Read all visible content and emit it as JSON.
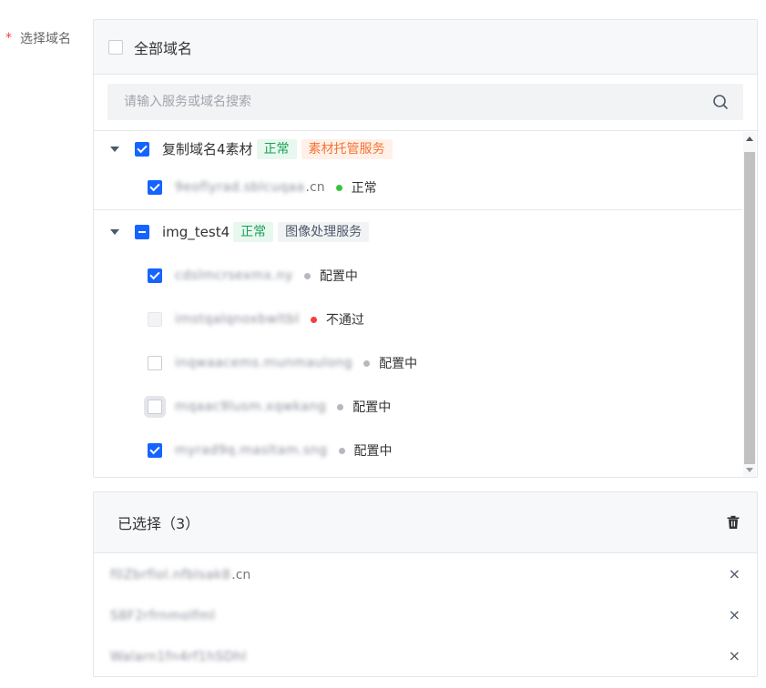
{
  "form": {
    "required_mark": "*",
    "label": "选择域名"
  },
  "panel": {
    "select_all_label": "全部域名",
    "search_placeholder": "请输入服务或域名搜索"
  },
  "groups": [
    {
      "name": "复制域名4素材",
      "state": "checked",
      "tags": [
        {
          "text": "正常",
          "style": "ok"
        },
        {
          "text": "素材托管服务",
          "style": "orange"
        }
      ],
      "domains": [
        {
          "masked": "9eoflyrad.sblcuqaa",
          "suffix": ".cn",
          "status": "正常",
          "status_color": "#3ac140",
          "state": "checked"
        }
      ]
    },
    {
      "name": "img_test4",
      "state": "indeterminate",
      "tags": [
        {
          "text": "正常",
          "style": "ok"
        },
        {
          "text": "图像处理服务",
          "style": "gray"
        }
      ],
      "domains": [
        {
          "masked": "cdslmcrsexmx.ny",
          "suffix": "",
          "status": "配置中",
          "status_color": "#b5b9c0",
          "state": "checked"
        },
        {
          "masked": "imstqalqnoxbwltbl",
          "suffix": "",
          "status": "不通过",
          "status_color": "#f53f3f",
          "state": "disabled"
        },
        {
          "masked": "inqwaacems.munmaulong",
          "suffix": "",
          "status": "配置中",
          "status_color": "#b5b9c0",
          "state": "unchecked"
        },
        {
          "masked": "mqaac9lusm.xqwkang",
          "suffix": "",
          "status": "配置中",
          "status_color": "#b5b9c0",
          "state": "focus"
        },
        {
          "masked": "myrad9q.masltam.sng",
          "suffix": "",
          "status": "配置中",
          "status_color": "#b5b9c0",
          "state": "checked"
        }
      ]
    }
  ],
  "selected": {
    "title": "已选择（3）",
    "items": [
      {
        "masked": "f0Zbrflol.nfblsak8",
        "suffix": ".cn"
      },
      {
        "masked": "S8F2rfrnmolfml",
        "suffix": ""
      },
      {
        "masked": "Walarn1fn4rf1hSDhl",
        "suffix": ""
      }
    ],
    "remove_icon": "×"
  },
  "colors": {
    "primary": "#1664ff",
    "required": "#f53f3f",
    "tag_ok_bg": "#e8f8ee",
    "tag_ok_text": "#18a058",
    "tag_orange_bg": "#fff1e8",
    "tag_orange_text": "#f77234"
  }
}
